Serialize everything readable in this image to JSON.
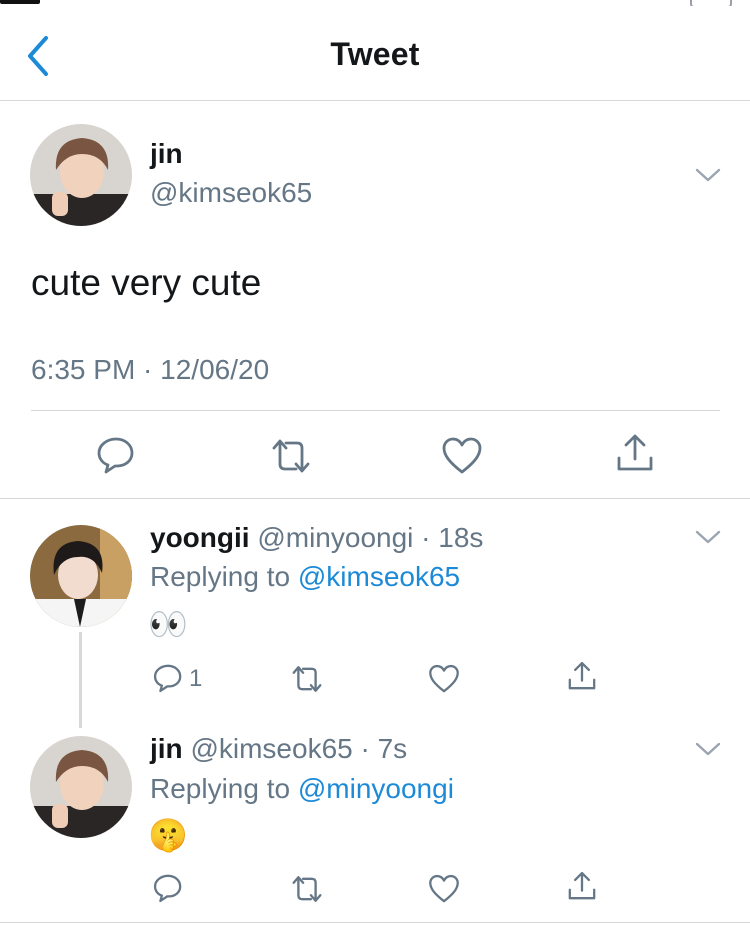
{
  "nav": {
    "title": "Tweet",
    "back_icon": "chevron-left-icon"
  },
  "main_tweet": {
    "name": "jin",
    "handle": "@kimseok65",
    "text": "cute very cute",
    "timestamp": "6:35 PM · 12/06/20",
    "actions": [
      "reply-icon",
      "retweet-icon",
      "like-icon",
      "share-icon"
    ]
  },
  "replies": [
    {
      "name": "yoongii",
      "handle": "@minyoongi",
      "sep": "·",
      "age": "18s",
      "replying_prefix": "Replying to ",
      "replying_to": "@kimseok65",
      "emoji": "👀",
      "reply_count": "1"
    },
    {
      "name": "jin",
      "handle": "@kimseok65",
      "sep": "·",
      "age": "7s",
      "replying_prefix": "Replying to ",
      "replying_to": "@minyoongi",
      "emoji": "🤫",
      "reply_count": ""
    }
  ],
  "colors": {
    "accent": "#1d8ad8",
    "secondary_text": "#657786",
    "divider": "#d6d9dc",
    "icon": "#657786"
  }
}
